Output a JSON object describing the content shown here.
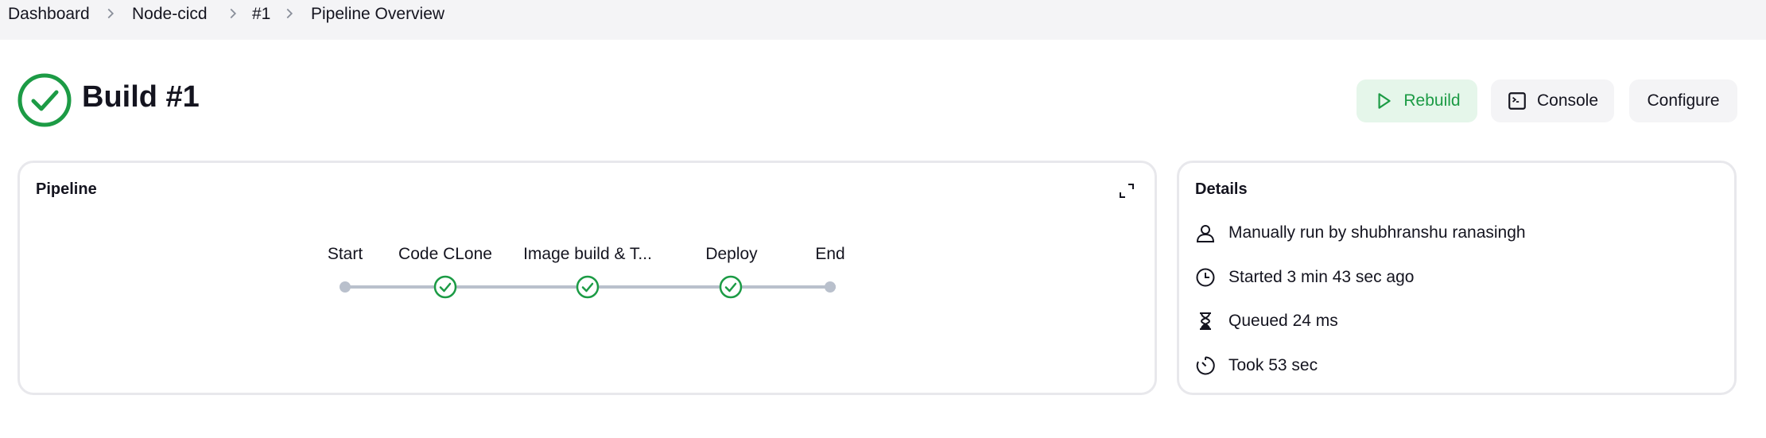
{
  "breadcrumb": {
    "items": [
      "Dashboard",
      "Node-cicd",
      "#1",
      "Pipeline Overview"
    ]
  },
  "header": {
    "title": "Build #1",
    "status_icon": "success-check-icon",
    "buttons": {
      "rebuild": "Rebuild",
      "console": "Console",
      "configure": "Configure"
    }
  },
  "pipeline": {
    "title": "Pipeline",
    "stages": [
      {
        "label": "Start",
        "status": "start"
      },
      {
        "label": "Code CLone",
        "status": "success"
      },
      {
        "label": "Image build & T...",
        "status": "success"
      },
      {
        "label": "Deploy",
        "status": "success"
      },
      {
        "label": "End",
        "status": "end"
      }
    ]
  },
  "details": {
    "title": "Details",
    "items": [
      {
        "icon": "user-icon",
        "text": "Manually run by shubhranshu ranasingh"
      },
      {
        "icon": "clock-icon",
        "text": "Started 3 min 43 sec ago"
      },
      {
        "icon": "hourglass-icon",
        "text": "Queued 24 ms"
      },
      {
        "icon": "timer-icon",
        "text": "Took 53 sec"
      }
    ]
  },
  "colors": {
    "success": "#1c9b45",
    "success_bg": "#e5f6ea",
    "neutral_bg": "#f4f4f6",
    "track": "#b9c0cc"
  }
}
